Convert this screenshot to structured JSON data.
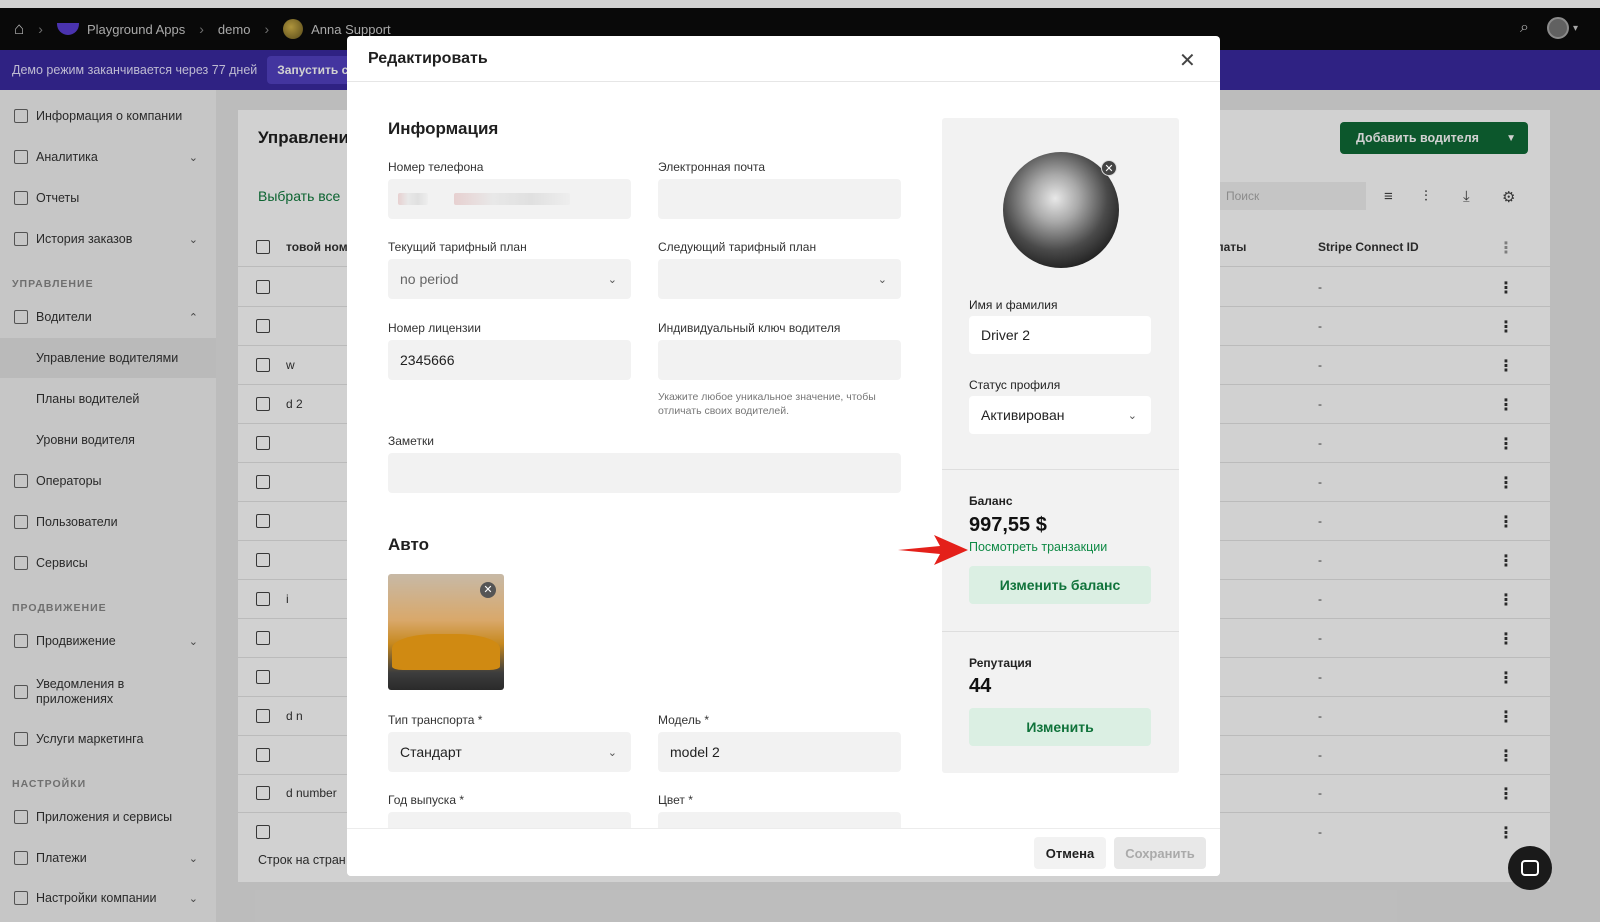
{
  "topbar": {
    "crumbs": [
      "Playground Apps",
      "demo",
      "Anna Support"
    ]
  },
  "demo": {
    "text": "Демо режим заканчивается через 77 дней",
    "button": "Запустить с"
  },
  "sidebar": {
    "items": [
      {
        "label": "Информация о компании"
      },
      {
        "label": "Аналитика"
      },
      {
        "label": "Отчеты"
      },
      {
        "label": "История заказов"
      }
    ],
    "section_manage": "УПРАВЛЕНИЕ",
    "drivers": "Водители",
    "subs": [
      "Управление водителями",
      "Планы водителей",
      "Уровни водителя"
    ],
    "manage_items": [
      "Операторы",
      "Пользователи",
      "Сервисы"
    ],
    "section_promo": "ПРОДВИЖЕНИЕ",
    "promo_items": [
      "Продвижение",
      "Уведомления в приложениях",
      "Услуги маркетинга"
    ],
    "section_settings": "НАСТРОЙКИ",
    "settings_items": [
      "Приложения и сервисы",
      "Платежи",
      "Настройки компании"
    ]
  },
  "page": {
    "title": "Управлени",
    "add_driver": "Добавить водителя",
    "select_all": "Выбрать все",
    "search_placeholder": "Поиск",
    "col_phone": "товой номе",
    "col_payments": "латы",
    "col_stripe": "Stripe Connect ID",
    "row_texts": [
      "w",
      "d 2",
      "i",
      "d n",
      "d number"
    ],
    "dash": "-",
    "rows_per_page": "Строк на стран"
  },
  "modal": {
    "title": "Редактировать",
    "info_title": "Информация",
    "phone_label": "Номер телефона",
    "email_label": "Электронная почта",
    "current_plan_label": "Текущий тарифный план",
    "current_plan_value": "no period",
    "next_plan_label": "Следующий тарифный план",
    "license_label": "Номер лицензии",
    "license_value": "2345666",
    "key_label": "Индивидуальный ключ водителя",
    "key_hint": "Укажите любое уникальное значение, чтобы отличать своих водителей.",
    "notes_label": "Заметки",
    "auto_title": "Авто",
    "transport_label": "Тип транспорта *",
    "transport_value": "Стандарт",
    "model_label": "Модель *",
    "model_value": "model 2",
    "year_label": "Год выпуска *",
    "color_label": "Цвет *",
    "name_label": "Имя и фамилия",
    "name_value": "Driver 2",
    "status_label": "Статус профиля",
    "status_value": "Активирован",
    "balance_label": "Баланс",
    "balance_value": "997,55 $",
    "view_transactions": "Посмотреть транзакции",
    "change_balance": "Изменить баланс",
    "reputation_label": "Репутация",
    "reputation_value": "44",
    "change": "Изменить",
    "cancel": "Отмена",
    "save": "Сохранить"
  }
}
